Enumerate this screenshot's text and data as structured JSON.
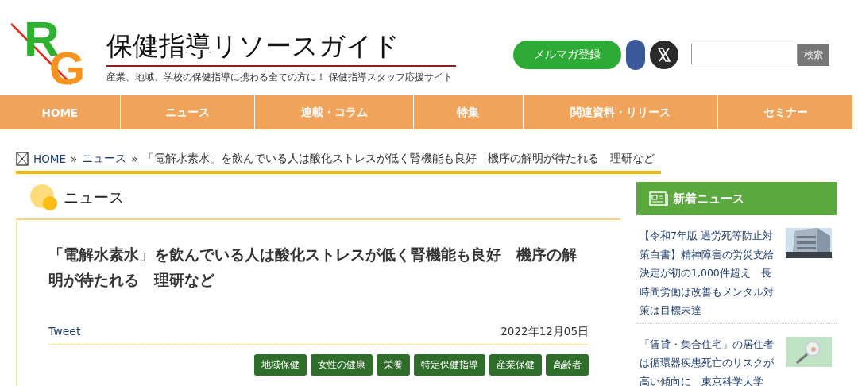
{
  "header": {
    "logo": {
      "letter_1": "R",
      "letter_2": "G"
    },
    "site_title": "保健指導リソースガイド",
    "tagline": "産業、地域、学校の保健指導に携わる全ての方に！ 保健指導スタッフ応援サイト",
    "newsletter_button": "メルマガ登録",
    "search_button": "検索"
  },
  "nav": [
    "HOME",
    "ニュース",
    "連載・コラム",
    "特集",
    "関連資料・リリース",
    "セミナー"
  ],
  "breadcrumb": {
    "links": [
      "HOME",
      "ニュース"
    ],
    "separator": "»",
    "current": "「電解水素水」を飲んでいる人は酸化ストレスが低く腎機能も良好　機序の解明が待たれる　理研など"
  },
  "section_title": "ニュース",
  "article": {
    "title": "「電解水素水」を飲んでいる人は酸化ストレスが低く腎機能も良好　機序の解明が待たれる　理研など",
    "tweet": "Tweet",
    "date": "2022年12月05日",
    "tags": [
      "地域保健",
      "女性の健康",
      "栄養",
      "特定保健指導",
      "産業保健",
      "高齢者"
    ]
  },
  "sidebar": {
    "title": "新着ニュース",
    "items": [
      {
        "text": "【令和7年版 過労死等防止対策白書】精神障害の労災支給決定が初の1,000件超え　長時間労働は改善もメンタル対策は目標未達"
      },
      {
        "text": "「賃貸・集合住宅」の居住者は循環器疾患死亡のリスクが高い傾向に　東京科学大学"
      }
    ]
  }
}
